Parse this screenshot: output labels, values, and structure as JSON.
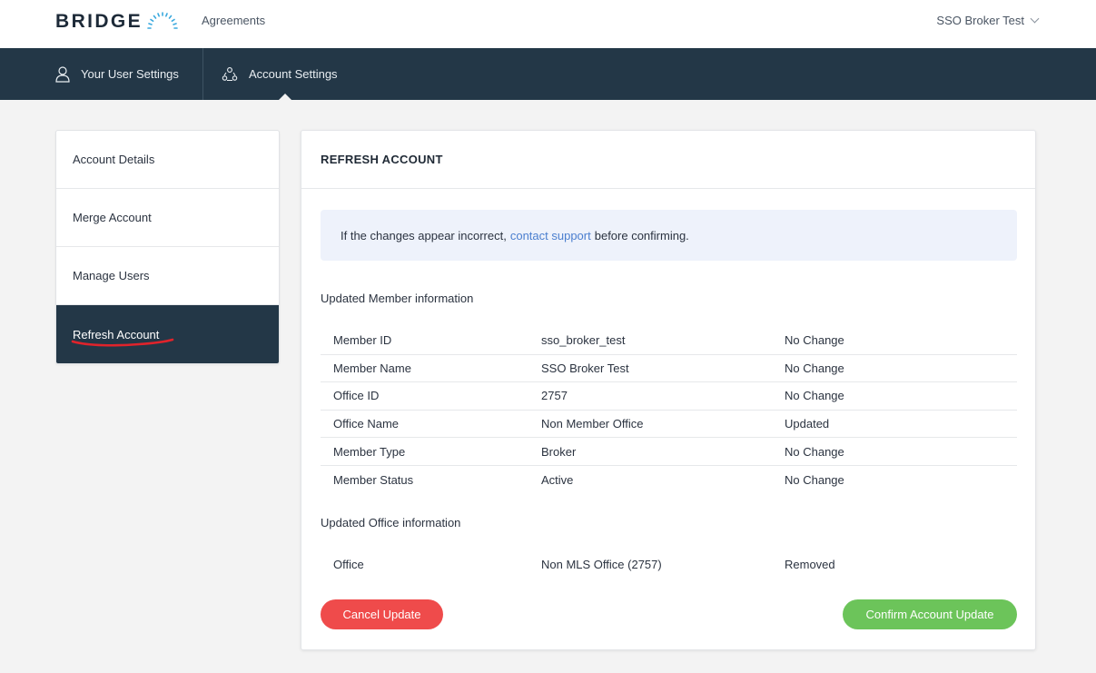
{
  "header": {
    "logo_text": "BRIDGE",
    "nav_link": "Agreements",
    "account_menu": "SSO Broker Test"
  },
  "nav": {
    "user_settings": "Your User Settings",
    "account_settings": "Account Settings"
  },
  "sidebar": {
    "items": [
      {
        "label": "Account Details"
      },
      {
        "label": "Merge Account"
      },
      {
        "label": "Manage Users"
      },
      {
        "label": "Refresh Account"
      }
    ],
    "active_index": 3
  },
  "main": {
    "title": "REFRESH ACCOUNT",
    "notice": {
      "before": "If the changes appear incorrect,",
      "link": "contact support",
      "after": "before confirming."
    },
    "member_section_title": "Updated Member information",
    "member_rows": [
      {
        "field": "Member ID",
        "value": "sso_broker_test",
        "status": "No Change"
      },
      {
        "field": "Member Name",
        "value": "SSO Broker Test",
        "status": "No Change"
      },
      {
        "field": "Office ID",
        "value": "2757",
        "status": "No Change"
      },
      {
        "field": "Office Name",
        "value": "Non Member Office",
        "status": "Updated"
      },
      {
        "field": "Member Type",
        "value": "Broker",
        "status": "No Change"
      },
      {
        "field": "Member Status",
        "value": "Active",
        "status": "No Change"
      }
    ],
    "office_section_title": "Updated Office information",
    "office_rows": [
      {
        "field": "Office",
        "value": "Non MLS Office (2757)",
        "status": "Removed"
      }
    ],
    "cancel_label": "Cancel Update",
    "confirm_label": "Confirm Account Update"
  },
  "colors": {
    "nav_bg": "#233747",
    "cancel": "#ef4b4b",
    "confirm": "#6cc45a",
    "link": "#4b7fcf",
    "notice_bg": "#eef2fb"
  }
}
